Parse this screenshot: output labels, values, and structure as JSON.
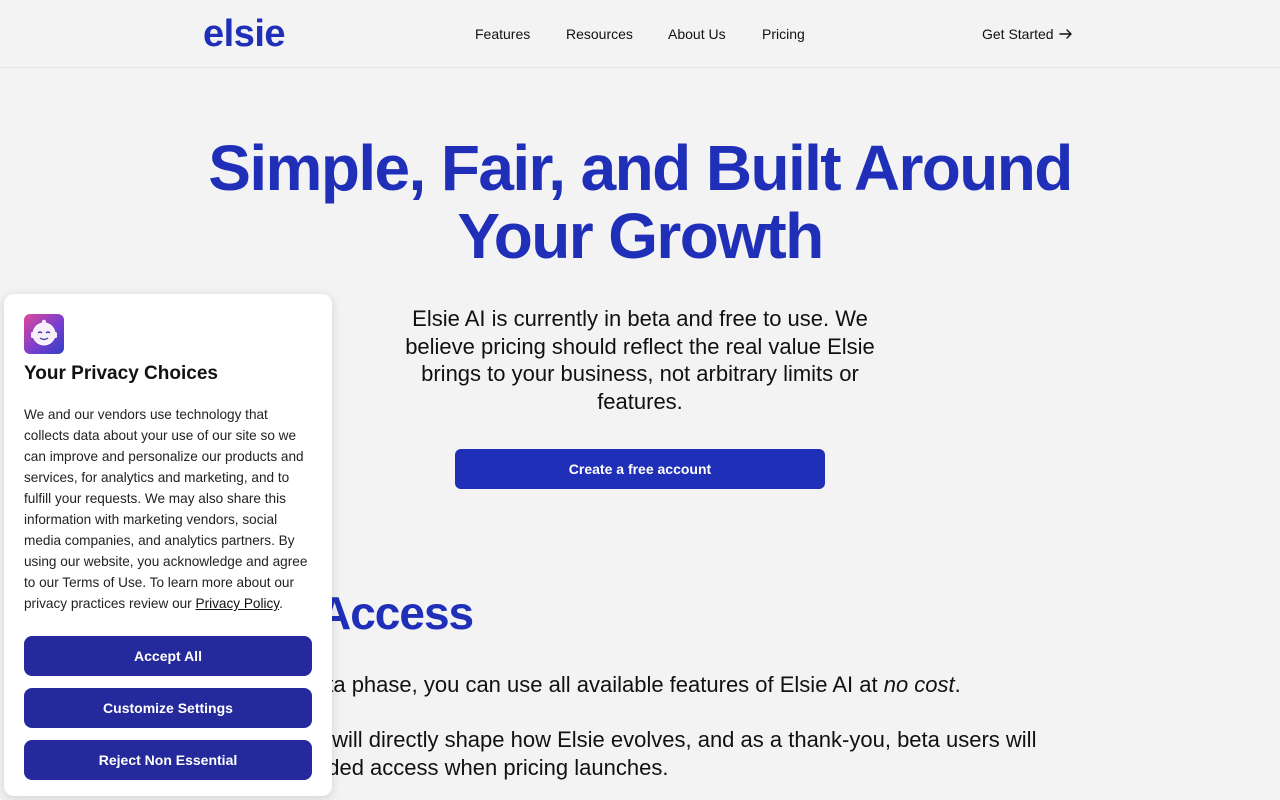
{
  "header": {
    "logo": "elsie",
    "nav": [
      {
        "label": "Features"
      },
      {
        "label": "Resources"
      },
      {
        "label": "About Us"
      },
      {
        "label": "Pricing"
      }
    ],
    "cta_label": "Get Started"
  },
  "hero": {
    "title_line1": "Simple, Fair, and Built Around",
    "title_line2": "Your Growth",
    "subtitle": "Elsie AI is currently in beta and free to use. We believe pricing should reflect the real value Elsie brings to your business, not arbitrary limits or features.",
    "button_label": "Create a free account"
  },
  "section": {
    "title_fragment": "Access",
    "para1_start": "eta phase, you can use all available features of Elsie AI at ",
    "para1_em": "no cost",
    "para1_end": ".",
    "para2_line1": "k will directly shape how Elsie evolves, and as a thank-you, beta users will",
    "para2_line2": "nded access when pricing launches."
  },
  "privacy": {
    "title": "Your Privacy Choices",
    "body": "We and our vendors use technology that collects data about your use of our site so we can improve and personalize our products and services, for analytics and marketing, and to fulfill your requests. We may also share this information with marketing vendors, social media companies, and analytics partners. By using our website, you acknowledge and agree to our Terms of Use. To learn more about our privacy practices review our ",
    "link": "Privacy Policy",
    "body_end": ".",
    "accept_label": "Accept All",
    "customize_label": "Customize Settings",
    "reject_label": "Reject Non Essential"
  },
  "colors": {
    "brand": "#1f2fb8",
    "privacy_button": "#24299c",
    "background": "#f3f3f4"
  }
}
